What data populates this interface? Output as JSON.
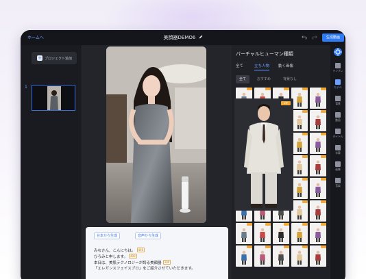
{
  "header": {
    "home_link": "ホームへ",
    "title": "美顔器DEMO6",
    "generate_button": "生成動画"
  },
  "left_panel": {
    "add_project": "プロジェクト追加",
    "slide_number": "1"
  },
  "script_panel": {
    "chips": [
      "台本から生成",
      "音声から生成"
    ],
    "lines": [
      {
        "text": "みなさん、こんにちは。",
        "tag": "400"
      },
      {
        "text": "ひろみと申します。",
        "tag": "400"
      },
      {
        "text": "本日は、美肌テクノロジーが誇る美顔器",
        "tag": "300"
      },
      {
        "text": "「エレガンスフェイスプロ」をご紹介させていただきます。",
        "tag": ""
      }
    ]
  },
  "right_panel": {
    "title": "バーチャルヒューマン種類",
    "tabs": [
      "全て",
      "立ち人物",
      "動く画像"
    ],
    "active_tab": "立ち人物",
    "subtabs": [
      "全て",
      "おすすめ",
      "背景なし"
    ],
    "popup_badge": "VIP"
  },
  "rail": {
    "items": [
      "テンプレ",
      "モデル",
      "背景",
      "動画",
      "タイトル",
      "字幕",
      "画像",
      "音楽"
    ],
    "active": "モデル"
  },
  "colors": {
    "accent": "#2f7bf6",
    "vip_badge": "#f2a93b",
    "dark_bg": "#1e1f25"
  }
}
